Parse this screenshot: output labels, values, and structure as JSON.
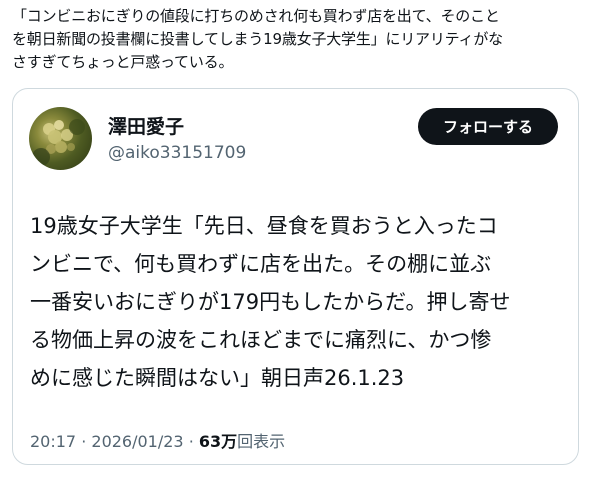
{
  "quote": {
    "lines": [
      "「コンビニおにぎりの値段に打ちのめされ何も買わず店を出て、そのこと",
      "を朝日新聞の投書欄に投書してしまう19歳女子大学生」にリアリティがな",
      "さすぎてちょっと戸惑っている。"
    ]
  },
  "tweet": {
    "author_name": "澤田愛子",
    "author_handle": "@aiko33151709",
    "follow_label": "フォローする",
    "body_lines": [
      "19歳女子大学生「先日、昼食を買おうと入ったコ",
      "ンビニで、何も買わずに店を出た。その棚に並ぶ",
      "一番安いおにぎりが179円もしたからだ。押し寄せ",
      "る物価上昇の波をこれほどまでに痛烈に、かつ惨",
      "めに感じた瞬間はない」朝日声26.1.23"
    ],
    "time": "20:17",
    "separator": "·",
    "date": "2026/01/23",
    "views_count": "63万",
    "views_label": "回表示"
  },
  "colors": {
    "text": "#0f1419",
    "muted": "#536471",
    "border": "#cfd9de",
    "button_bg": "#0f1419"
  }
}
